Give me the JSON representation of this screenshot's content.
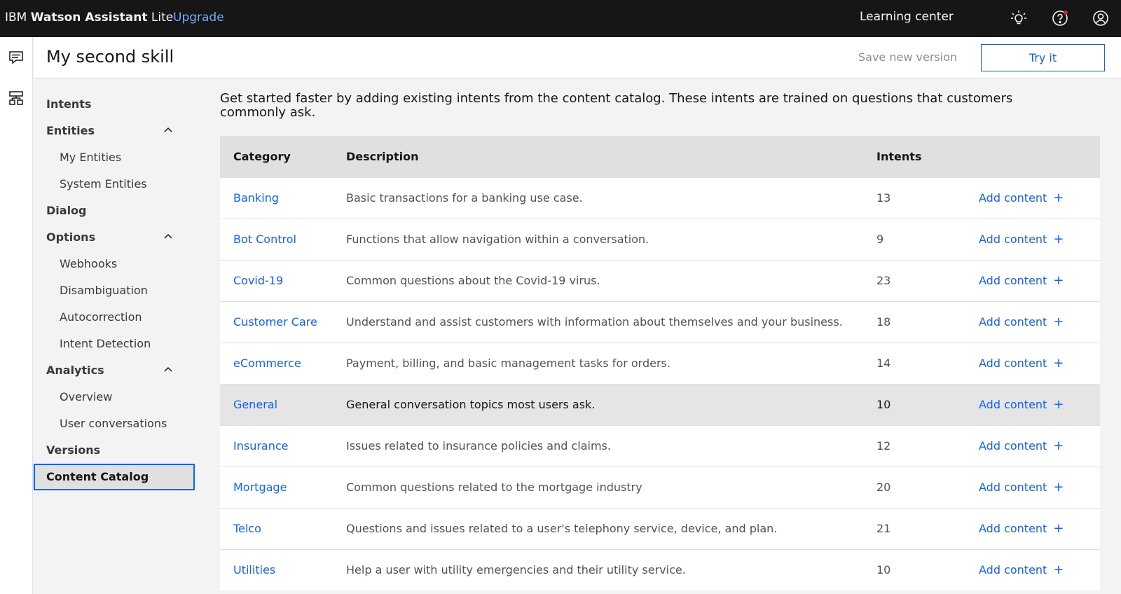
{
  "topbar": {
    "brand_prefix": "IBM ",
    "brand_bold": "Watson Assistant",
    "brand_suffix": " Lite",
    "upgrade": "Upgrade",
    "learning_center": "Learning center",
    "icons": [
      "lightbulb-icon",
      "help-icon",
      "user-icon"
    ],
    "notification_color": "#da1e28"
  },
  "rail": {
    "icons": [
      "chat-icon",
      "skills-icon"
    ]
  },
  "skill": {
    "title": "My second skill",
    "save_new_version": "Save new version",
    "try_it": "Try it"
  },
  "sidenav": {
    "items": [
      {
        "label": "Intents",
        "level": "top"
      },
      {
        "label": "Entities",
        "level": "top",
        "expanded": true
      },
      {
        "label": "My Entities",
        "level": "sub"
      },
      {
        "label": "System Entities",
        "level": "sub"
      },
      {
        "label": "Dialog",
        "level": "top"
      },
      {
        "label": "Options",
        "level": "top",
        "expanded": true
      },
      {
        "label": "Webhooks",
        "level": "sub"
      },
      {
        "label": "Disambiguation",
        "level": "sub"
      },
      {
        "label": "Autocorrection",
        "level": "sub"
      },
      {
        "label": "Intent Detection",
        "level": "sub"
      },
      {
        "label": "Analytics",
        "level": "top",
        "expanded": true
      },
      {
        "label": "Overview",
        "level": "sub"
      },
      {
        "label": "User conversations",
        "level": "sub"
      },
      {
        "label": "Versions",
        "level": "top"
      },
      {
        "label": "Content Catalog",
        "level": "top",
        "active": true
      }
    ]
  },
  "main": {
    "intro": "Get started faster by adding existing intents from the content catalog. These intents are trained on questions that customers commonly ask.",
    "table": {
      "headers": {
        "category": "Category",
        "description": "Description",
        "intents": "Intents"
      },
      "add_label": "Add content",
      "add_symbol": "+",
      "rows": [
        {
          "category": "Banking",
          "description": "Basic transactions for a banking use case.",
          "intents": "13"
        },
        {
          "category": "Bot Control",
          "description": "Functions that allow navigation within a conversation.",
          "intents": "9"
        },
        {
          "category": "Covid-19",
          "description": "Common questions about the Covid-19 virus.",
          "intents": "23"
        },
        {
          "category": "Customer Care",
          "description": "Understand and assist customers with information about themselves and your business.",
          "intents": "18"
        },
        {
          "category": "eCommerce",
          "description": "Payment, billing, and basic management tasks for orders.",
          "intents": "14"
        },
        {
          "category": "General",
          "description": "General conversation topics most users ask.",
          "intents": "10",
          "highlighted": true
        },
        {
          "category": "Insurance",
          "description": "Issues related to insurance policies and claims.",
          "intents": "12"
        },
        {
          "category": "Mortgage",
          "description": "Common questions related to the mortgage industry",
          "intents": "20"
        },
        {
          "category": "Telco",
          "description": "Questions and issues related to a user's telephony service, device, and plan.",
          "intents": "21"
        },
        {
          "category": "Utilities",
          "description": "Help a user with utility emergencies and their utility service.",
          "intents": "10"
        }
      ]
    }
  },
  "colors": {
    "accent": "#0f62fe",
    "topbar_bg": "#161616",
    "upgrade_link": "#78a9ff"
  }
}
